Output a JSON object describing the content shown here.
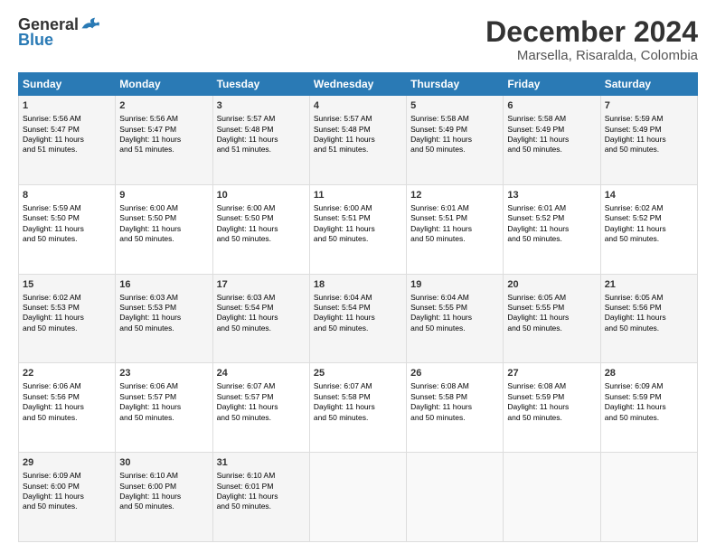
{
  "header": {
    "logo_general": "General",
    "logo_blue": "Blue",
    "title": "December 2024",
    "subtitle": "Marsella, Risaralda, Colombia"
  },
  "days_of_week": [
    "Sunday",
    "Monday",
    "Tuesday",
    "Wednesday",
    "Thursday",
    "Friday",
    "Saturday"
  ],
  "weeks": [
    [
      {
        "day": 1,
        "sunrise": "5:56 AM",
        "sunset": "5:47 PM",
        "daylight": "11 hours and 51 minutes."
      },
      {
        "day": 2,
        "sunrise": "5:56 AM",
        "sunset": "5:47 PM",
        "daylight": "11 hours and 51 minutes."
      },
      {
        "day": 3,
        "sunrise": "5:57 AM",
        "sunset": "5:48 PM",
        "daylight": "11 hours and 51 minutes."
      },
      {
        "day": 4,
        "sunrise": "5:57 AM",
        "sunset": "5:48 PM",
        "daylight": "11 hours and 51 minutes."
      },
      {
        "day": 5,
        "sunrise": "5:58 AM",
        "sunset": "5:49 PM",
        "daylight": "11 hours and 50 minutes."
      },
      {
        "day": 6,
        "sunrise": "5:58 AM",
        "sunset": "5:49 PM",
        "daylight": "11 hours and 50 minutes."
      },
      {
        "day": 7,
        "sunrise": "5:59 AM",
        "sunset": "5:49 PM",
        "daylight": "11 hours and 50 minutes."
      }
    ],
    [
      {
        "day": 8,
        "sunrise": "5:59 AM",
        "sunset": "5:50 PM",
        "daylight": "11 hours and 50 minutes."
      },
      {
        "day": 9,
        "sunrise": "6:00 AM",
        "sunset": "5:50 PM",
        "daylight": "11 hours and 50 minutes."
      },
      {
        "day": 10,
        "sunrise": "6:00 AM",
        "sunset": "5:50 PM",
        "daylight": "11 hours and 50 minutes."
      },
      {
        "day": 11,
        "sunrise": "6:00 AM",
        "sunset": "5:51 PM",
        "daylight": "11 hours and 50 minutes."
      },
      {
        "day": 12,
        "sunrise": "6:01 AM",
        "sunset": "5:51 PM",
        "daylight": "11 hours and 50 minutes."
      },
      {
        "day": 13,
        "sunrise": "6:01 AM",
        "sunset": "5:52 PM",
        "daylight": "11 hours and 50 minutes."
      },
      {
        "day": 14,
        "sunrise": "6:02 AM",
        "sunset": "5:52 PM",
        "daylight": "11 hours and 50 minutes."
      }
    ],
    [
      {
        "day": 15,
        "sunrise": "6:02 AM",
        "sunset": "5:53 PM",
        "daylight": "11 hours and 50 minutes."
      },
      {
        "day": 16,
        "sunrise": "6:03 AM",
        "sunset": "5:53 PM",
        "daylight": "11 hours and 50 minutes."
      },
      {
        "day": 17,
        "sunrise": "6:03 AM",
        "sunset": "5:54 PM",
        "daylight": "11 hours and 50 minutes."
      },
      {
        "day": 18,
        "sunrise": "6:04 AM",
        "sunset": "5:54 PM",
        "daylight": "11 hours and 50 minutes."
      },
      {
        "day": 19,
        "sunrise": "6:04 AM",
        "sunset": "5:55 PM",
        "daylight": "11 hours and 50 minutes."
      },
      {
        "day": 20,
        "sunrise": "6:05 AM",
        "sunset": "5:55 PM",
        "daylight": "11 hours and 50 minutes."
      },
      {
        "day": 21,
        "sunrise": "6:05 AM",
        "sunset": "5:56 PM",
        "daylight": "11 hours and 50 minutes."
      }
    ],
    [
      {
        "day": 22,
        "sunrise": "6:06 AM",
        "sunset": "5:56 PM",
        "daylight": "11 hours and 50 minutes."
      },
      {
        "day": 23,
        "sunrise": "6:06 AM",
        "sunset": "5:57 PM",
        "daylight": "11 hours and 50 minutes."
      },
      {
        "day": 24,
        "sunrise": "6:07 AM",
        "sunset": "5:57 PM",
        "daylight": "11 hours and 50 minutes."
      },
      {
        "day": 25,
        "sunrise": "6:07 AM",
        "sunset": "5:58 PM",
        "daylight": "11 hours and 50 minutes."
      },
      {
        "day": 26,
        "sunrise": "6:08 AM",
        "sunset": "5:58 PM",
        "daylight": "11 hours and 50 minutes."
      },
      {
        "day": 27,
        "sunrise": "6:08 AM",
        "sunset": "5:59 PM",
        "daylight": "11 hours and 50 minutes."
      },
      {
        "day": 28,
        "sunrise": "6:09 AM",
        "sunset": "5:59 PM",
        "daylight": "11 hours and 50 minutes."
      }
    ],
    [
      {
        "day": 29,
        "sunrise": "6:09 AM",
        "sunset": "6:00 PM",
        "daylight": "11 hours and 50 minutes."
      },
      {
        "day": 30,
        "sunrise": "6:10 AM",
        "sunset": "6:00 PM",
        "daylight": "11 hours and 50 minutes."
      },
      {
        "day": 31,
        "sunrise": "6:10 AM",
        "sunset": "6:01 PM",
        "daylight": "11 hours and 50 minutes."
      },
      null,
      null,
      null,
      null
    ]
  ]
}
